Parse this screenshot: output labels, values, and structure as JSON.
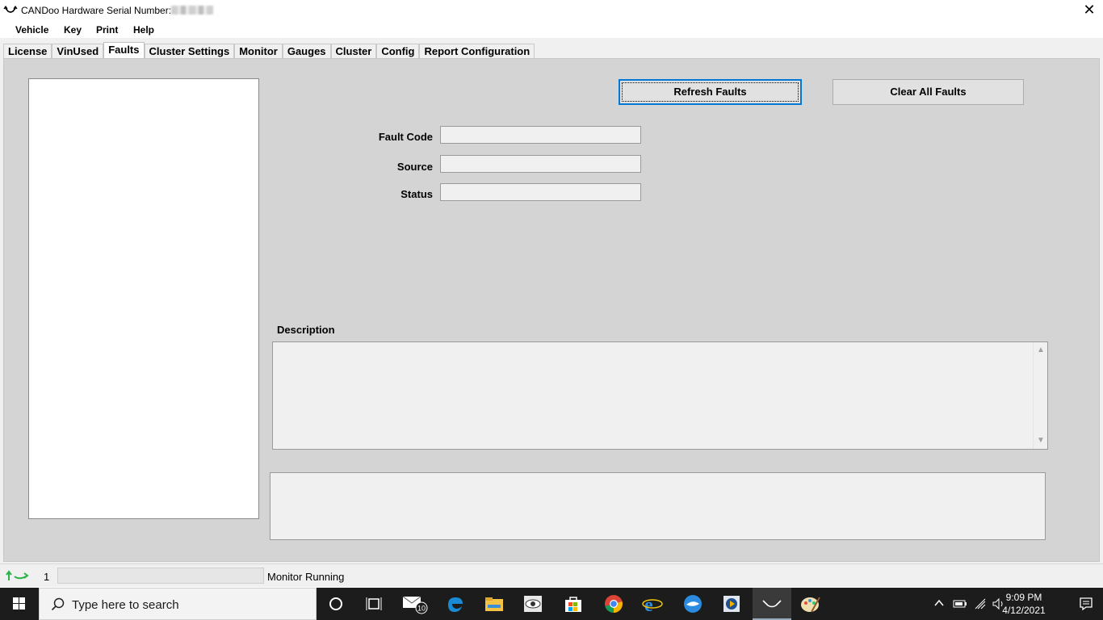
{
  "window": {
    "title": "CANDoo  Hardware Serial Number:",
    "close_glyph": "✕"
  },
  "menu": {
    "items": [
      {
        "label": "Vehicle"
      },
      {
        "label": "Key"
      },
      {
        "label": "Print"
      },
      {
        "label": "Help"
      }
    ]
  },
  "tabs": [
    {
      "label": "License"
    },
    {
      "label": "VinUsed"
    },
    {
      "label": "Faults",
      "active": true
    },
    {
      "label": "Cluster Settings"
    },
    {
      "label": "Monitor"
    },
    {
      "label": "Gauges"
    },
    {
      "label": "Cluster"
    },
    {
      "label": "Config"
    },
    {
      "label": "Report Configuration"
    }
  ],
  "faults_panel": {
    "refresh_button": "Refresh Faults",
    "clear_button": "Clear All Faults",
    "fault_code_label": "Fault Code",
    "fault_code_value": "",
    "source_label": "Source",
    "source_value": "",
    "status_label": "Status",
    "status_value": "",
    "description_label": "Description",
    "description_value": "",
    "message_value": ""
  },
  "statusbar": {
    "count": "1",
    "status_text": "Monitor Running"
  },
  "taskbar": {
    "search_placeholder": "Type here to search",
    "mail_badge": "10",
    "time": "9:09 PM",
    "date": "4/12/2021",
    "icons": [
      "windows-start-icon",
      "cortana-icon",
      "task-view-icon",
      "mail-icon",
      "edge-icon",
      "file-explorer-icon",
      "eye-app-icon",
      "store-icon",
      "chrome-icon",
      "internet-explorer-icon",
      "thunderbird-icon",
      "media-app-icon",
      "candoo-icon",
      "paint-icon"
    ]
  },
  "colors": {
    "panel_bg": "#d4d4d4",
    "default_button_border": "#0078d7",
    "taskbar_bg": "#1c1c1c"
  }
}
